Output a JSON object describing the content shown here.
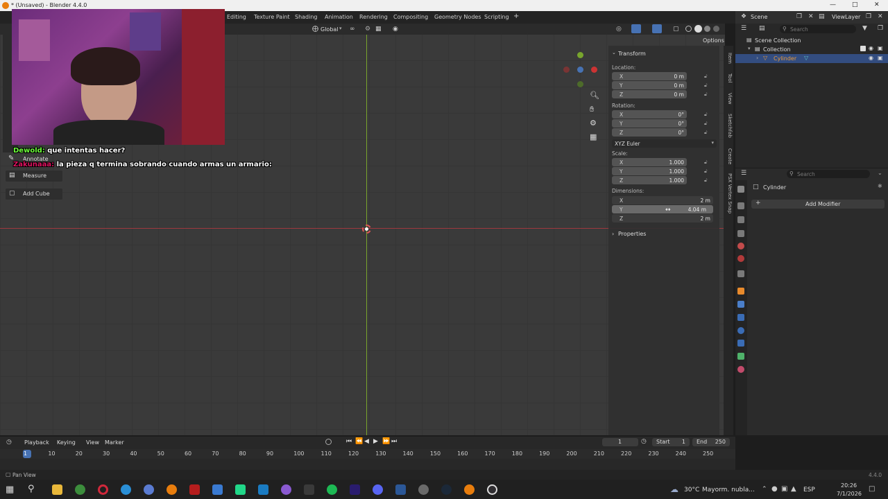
{
  "window": {
    "title": "* (Unsaved) - Blender 4.4.0"
  },
  "workspaces": [
    "Editing",
    "Texture Paint",
    "Shading",
    "Animation",
    "Rendering",
    "Compositing",
    "Geometry Nodes",
    "Scripting",
    "+"
  ],
  "viewport_header": {
    "orientation": "Global",
    "options_label": "Options"
  },
  "tools": {
    "annotate": "Annotate",
    "measure": "Measure",
    "add_cube": "Add Cube"
  },
  "chat": [
    {
      "user": "Dewold:",
      "message": "que intentas hacer?",
      "color": "#6cff3a"
    },
    {
      "user": "Zakunaaa:",
      "message": "la pieza q termina sobrando cuando armas un armario:",
      "color": "#e0115f"
    }
  ],
  "npanel": {
    "section": "Transform",
    "location_label": "Location:",
    "location": [
      {
        "axis": "X",
        "value": "0 m"
      },
      {
        "axis": "Y",
        "value": "0 m"
      },
      {
        "axis": "Z",
        "value": "0 m"
      }
    ],
    "rotation_label": "Rotation:",
    "rotation": [
      {
        "axis": "X",
        "value": "0°"
      },
      {
        "axis": "Y",
        "value": "0°"
      },
      {
        "axis": "Z",
        "value": "0°"
      }
    ],
    "rotation_mode": "XYZ Euler",
    "scale_label": "Scale:",
    "scale": [
      {
        "axis": "X",
        "value": "1.000"
      },
      {
        "axis": "Y",
        "value": "1.000"
      },
      {
        "axis": "Z",
        "value": "1.000"
      }
    ],
    "dimensions_label": "Dimensions:",
    "dimensions": [
      {
        "axis": "X",
        "value": "2 m"
      },
      {
        "axis": "Y",
        "value": "4.04 m"
      },
      {
        "axis": "Z",
        "value": "2 m"
      }
    ],
    "properties": "Properties",
    "side_tabs": [
      "Item",
      "Tool",
      "View",
      "Sketchfab",
      "Create",
      "PSX Vertex Snap"
    ]
  },
  "outliner": {
    "scene": "Scene",
    "view_layer": "ViewLayer",
    "search_placeholder": "Search",
    "scene_collection": "Scene Collection",
    "collection": "Collection",
    "object": "Cylinder"
  },
  "properties": {
    "search_placeholder": "Search",
    "object": "Cylinder",
    "add_modifier": "Add Modifier"
  },
  "timeline": {
    "menus": [
      "Playback",
      "Keying",
      "View",
      "Marker"
    ],
    "current_frame": "1",
    "start_label": "Start",
    "start": "1",
    "end_label": "End",
    "end": "250",
    "ticks": [
      "1",
      "10",
      "20",
      "30",
      "40",
      "50",
      "60",
      "70",
      "80",
      "90",
      "100",
      "110",
      "120",
      "130",
      "140",
      "150",
      "160",
      "170",
      "180",
      "190",
      "200",
      "210",
      "220",
      "230",
      "240",
      "250"
    ]
  },
  "status": {
    "hint": "Pan View",
    "version": "4.4.0"
  },
  "taskbar": {
    "weather": "30°C",
    "weather_text": "Mayorm. nubla...",
    "lang": "ESP",
    "time": "20:26",
    "date": "7/1/2026"
  },
  "colors": {
    "accent": "#4772b3",
    "x_axis": "#a0383e",
    "y_axis": "#78a52d",
    "highlight": "#334d80"
  }
}
